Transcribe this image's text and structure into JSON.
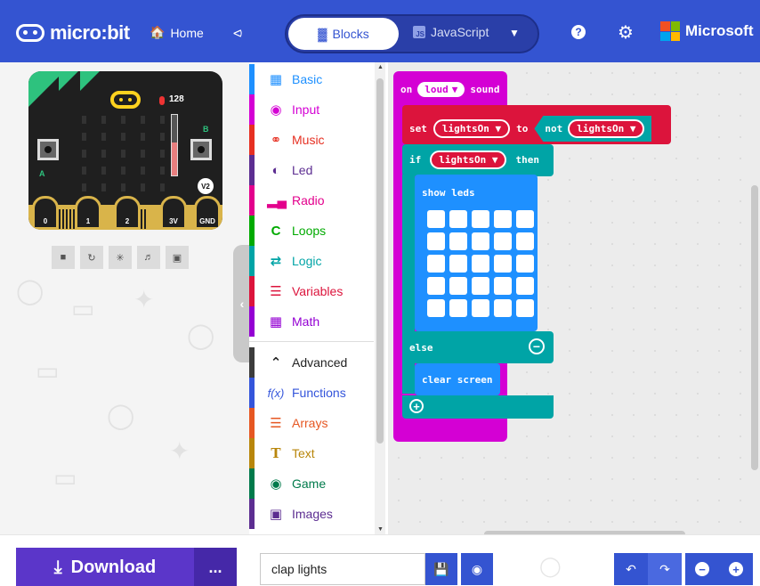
{
  "header": {
    "brand": "micro:bit",
    "home_label": "Home",
    "tabs": {
      "blocks": "Blocks",
      "javascript": "JavaScript"
    },
    "js_badge": "JS",
    "microsoft": "Microsoft"
  },
  "simulator": {
    "sound_level": "128",
    "badge": "V2",
    "button_a": "A",
    "button_b": "B",
    "pins": [
      "0",
      "1",
      "2",
      "3V",
      "GND"
    ]
  },
  "toolbox": {
    "items": [
      {
        "label": "Basic",
        "color": "#1E90FF",
        "icon": "grid-icon"
      },
      {
        "label": "Input",
        "color": "#D400D4",
        "icon": "target-icon"
      },
      {
        "label": "Music",
        "color": "#E63022",
        "icon": "headphones-icon"
      },
      {
        "label": "Led",
        "color": "#5C2D91",
        "icon": "toggle-icon"
      },
      {
        "label": "Radio",
        "color": "#E3008C",
        "icon": "signal-icon"
      },
      {
        "label": "Loops",
        "color": "#00AA00",
        "icon": "loop-icon"
      },
      {
        "label": "Logic",
        "color": "#00A4A6",
        "icon": "shuffle-icon"
      },
      {
        "label": "Variables",
        "color": "#DC143C",
        "icon": "lines-icon"
      },
      {
        "label": "Math",
        "color": "#9400D3",
        "icon": "calculator-icon"
      },
      {
        "label": "Advanced",
        "color": "#3C3C3C",
        "icon": "chevron-up-icon"
      },
      {
        "label": "Functions",
        "color": "#3455DB",
        "icon": "function-icon"
      },
      {
        "label": "Arrays",
        "color": "#E65722",
        "icon": "list-icon"
      },
      {
        "label": "Text",
        "color": "#B8860B",
        "icon": "text-icon"
      },
      {
        "label": "Game",
        "color": "#007A4B",
        "icon": "gamepad-icon"
      },
      {
        "label": "Images",
        "color": "#5C2D91",
        "icon": "image-icon"
      }
    ]
  },
  "workspace": {
    "event": {
      "on": "on",
      "dropdown": "loud",
      "suffix": "sound"
    },
    "set": {
      "keyword": "set",
      "variable": "lightsOn",
      "to": "to",
      "not": "not",
      "value": "lightsOn"
    },
    "if": {
      "keyword": "if",
      "variable": "lightsOn",
      "then": "then"
    },
    "show_leds": "show leds",
    "else": "else",
    "clear_screen": "clear screen"
  },
  "footer": {
    "download": "Download",
    "more": "...",
    "project_name": "clap lights"
  }
}
